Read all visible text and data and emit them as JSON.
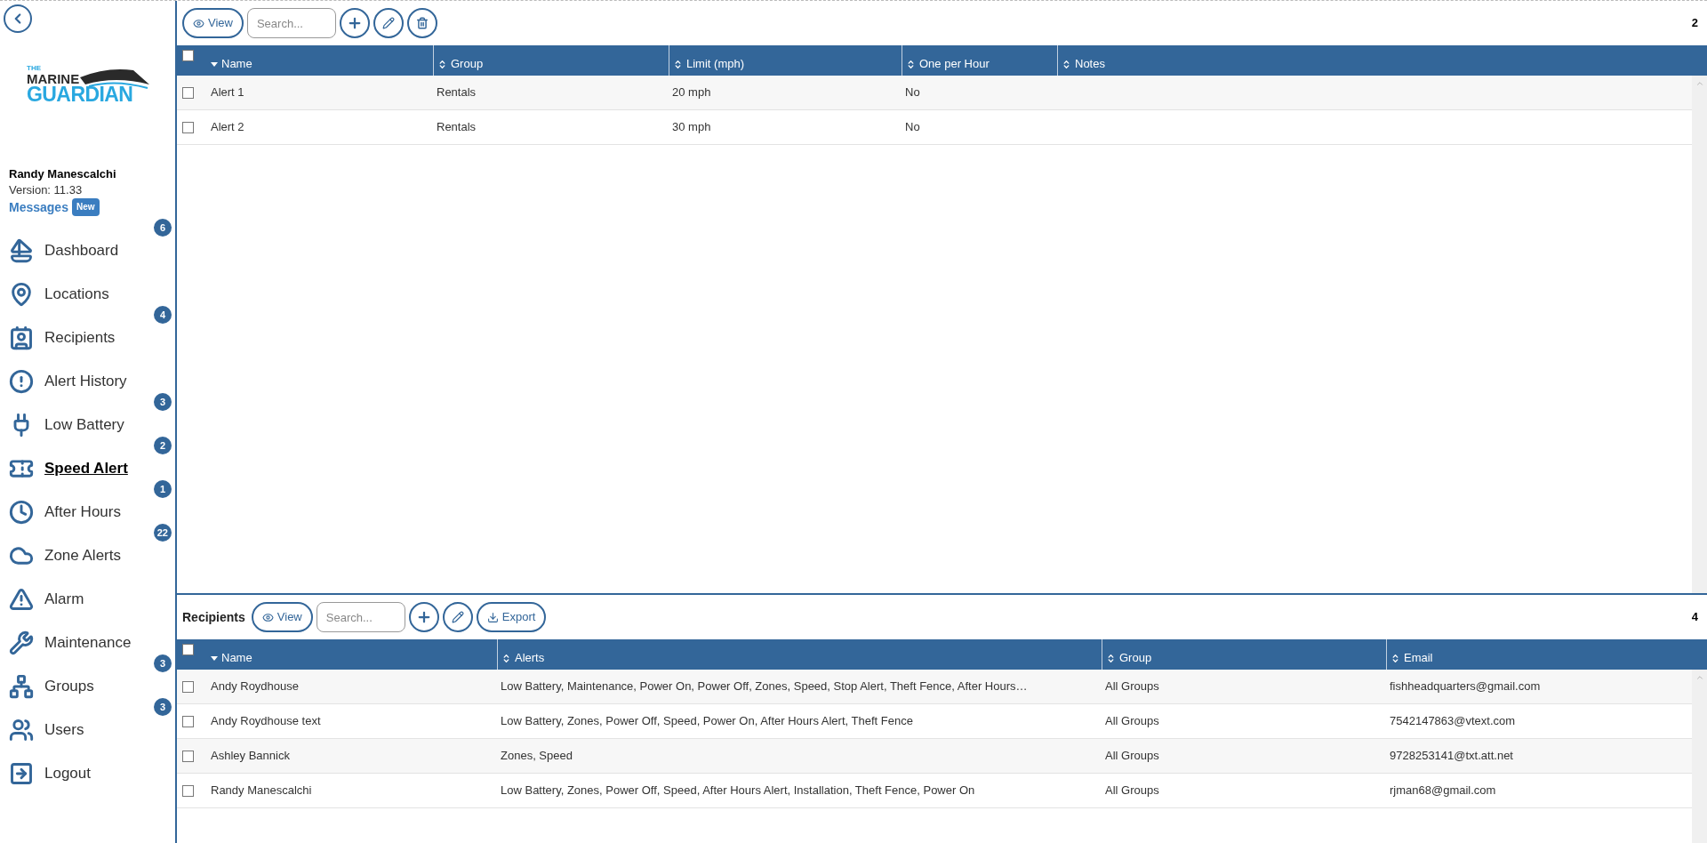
{
  "sidebar": {
    "logo": {
      "line1": "THE",
      "line2": "MARINE",
      "line3": "GUARDIAN"
    },
    "user": {
      "name": "Randy Manescalchi",
      "version": "Version: 11.33",
      "messages_link": "Messages",
      "messages_badge": "New"
    },
    "nav": [
      {
        "label": "Dashboard",
        "badge": "6",
        "selected": false
      },
      {
        "label": "Locations",
        "selected": false
      },
      {
        "label": "Recipients",
        "badge": "4",
        "selected": false
      },
      {
        "label": "Alert History",
        "selected": false
      },
      {
        "label": "Low Battery",
        "badge": "3",
        "selected": false
      },
      {
        "label": "Speed Alert",
        "badge": "2",
        "selected": true
      },
      {
        "label": "After Hours",
        "badge": "1",
        "selected": false
      },
      {
        "label": "Zone Alerts",
        "badge": "22",
        "selected": false
      },
      {
        "label": "Alarm",
        "selected": false
      },
      {
        "label": "Maintenance",
        "selected": false
      },
      {
        "label": "Groups",
        "badge": "3",
        "selected": false
      },
      {
        "label": "Users",
        "badge": "3",
        "selected": false
      },
      {
        "label": "Logout",
        "selected": false
      }
    ]
  },
  "alerts_panel": {
    "toolbar": {
      "view_button": "View",
      "search_placeholder": "Search..."
    },
    "count": "2",
    "select_all_checked": false,
    "columns": [
      {
        "label": "Name",
        "sorted": true
      },
      {
        "label": "Group",
        "sorted": false
      },
      {
        "label": "Limit (mph)",
        "sorted": false
      },
      {
        "label": "One per Hour",
        "sorted": false
      },
      {
        "label": "Notes",
        "sorted": false
      }
    ],
    "rows": [
      {
        "checked": false,
        "cells": [
          "Alert 1",
          "Rentals",
          "20 mph",
          "No",
          ""
        ]
      },
      {
        "checked": false,
        "cells": [
          "Alert 2",
          "Rentals",
          "30 mph",
          "No",
          ""
        ]
      }
    ]
  },
  "recipients_panel": {
    "title": "Recipients",
    "toolbar": {
      "view_button": "View",
      "search_placeholder": "Search...",
      "export_button": "Export"
    },
    "count": "4",
    "select_all_checked": false,
    "columns": [
      {
        "label": "Name",
        "sorted": true
      },
      {
        "label": "Alerts",
        "sorted": false
      },
      {
        "label": "Group",
        "sorted": false
      },
      {
        "label": "Email",
        "sorted": false
      }
    ],
    "rows": [
      {
        "checked": false,
        "cells": [
          "Andy Roydhouse",
          "Low Battery, Maintenance, Power On, Power Off, Zones, Speed, Stop Alert, Theft Fence, After Hours…",
          "All Groups",
          "fishheadquarters@gmail.com"
        ]
      },
      {
        "checked": false,
        "cells": [
          "Andy Roydhouse text",
          "Low Battery, Zones, Power Off, Speed, Power On, After Hours Alert, Theft Fence",
          "All Groups",
          "7542147863@vtext.com"
        ]
      },
      {
        "checked": false,
        "cells": [
          "Ashley Bannick",
          "Zones, Speed",
          "All Groups",
          "9728253141@txt.att.net"
        ]
      },
      {
        "checked": false,
        "cells": [
          "Randy Manescalchi",
          "Low Battery, Zones, Power Off, Speed, After Hours Alert, Installation, Theft Fence, Power On",
          "All Groups",
          "rjman68@gmail.com"
        ]
      }
    ]
  }
}
